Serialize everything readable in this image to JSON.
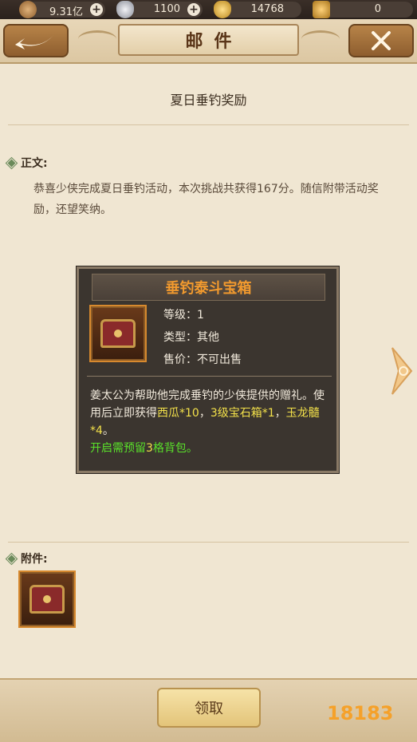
{
  "currencies": [
    {
      "name": "copper-coin-icon",
      "value": "9.31亿",
      "has_plus": true,
      "color": "#c58a52"
    },
    {
      "name": "silver-ingot-icon",
      "value": "1100",
      "has_plus": true,
      "color": "#c8ccd4"
    },
    {
      "name": "gold-ingot-icon",
      "value": "14768",
      "has_plus": false,
      "color": "#e8b63a"
    },
    {
      "name": "locked-gold-icon",
      "value": "0",
      "has_plus": false,
      "color": "#e0a83a"
    }
  ],
  "header": {
    "title": "邮件",
    "back_icon": "back-arrow-icon",
    "close_icon": "close-icon"
  },
  "mail": {
    "subject": "夏日垂钓奖励",
    "body_label": "正文:",
    "body": "恭喜少侠完成夏日垂钓活动，本次挑战共获得167分。随信附带活动奖励，还望笑纳。",
    "attachments_label": "附件:"
  },
  "item_popup": {
    "name": "垂钓泰斗宝箱",
    "level_label": "等级：",
    "level_value": "1",
    "type_label": "类型：",
    "type_value": "其他",
    "price_label": "售价：",
    "price_value": "不可出售",
    "desc_part1": "姜太公为帮助他完成垂钓的少侠提供的赠礼。使用后立即获得",
    "desc_hl1": "西瓜*10",
    "desc_sep1": "，",
    "desc_hl2": "3级宝石箱*1",
    "desc_sep2": "，",
    "desc_hl3": "玉龙髓*4",
    "desc_end": "。",
    "desc_green1": "开启需预留",
    "desc_green_num": "3",
    "desc_green2": "格背包。"
  },
  "buttons": {
    "claim": "领取"
  },
  "watermark": "18183",
  "colors": {
    "accent_orange": "#f29a2e",
    "highlight_yellow": "#f2e04a",
    "highlight_green": "#59e02a"
  }
}
